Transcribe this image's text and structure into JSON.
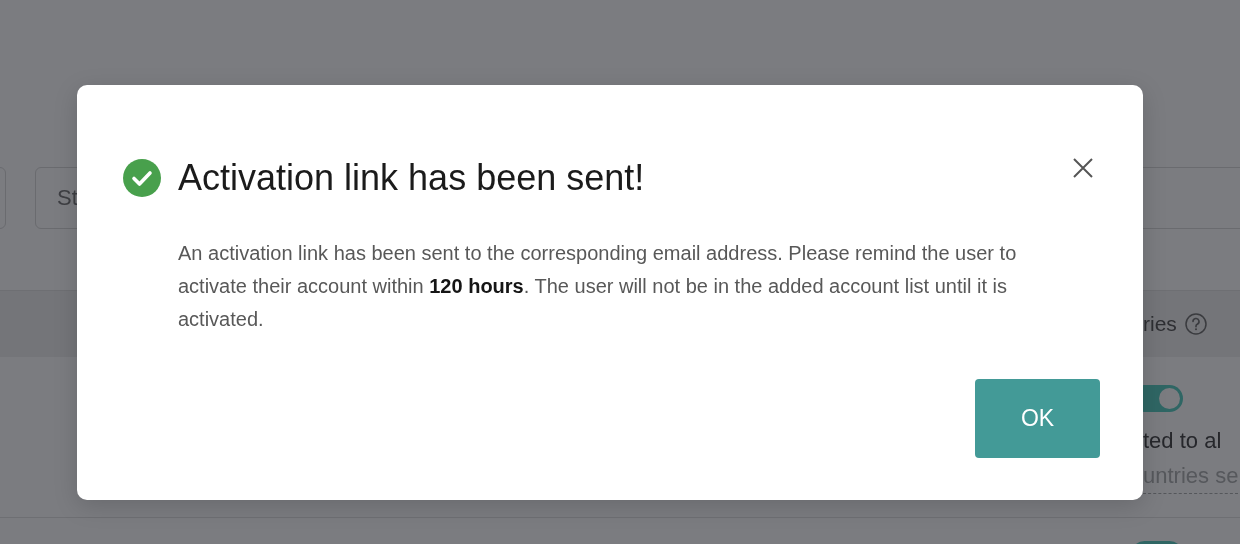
{
  "background": {
    "search": {
      "placeholder": "St"
    },
    "table": {
      "column_header": "ries",
      "rows": [
        {
          "toggle_on": true,
          "line_1": "ted to al",
          "line_2": "untries se"
        },
        {
          "toggle_on": true
        }
      ]
    }
  },
  "dialog": {
    "title": "Activation link has been sent!",
    "kind": "success",
    "message": "An activation link has been sent to the corresponding email address. Please remind the user to activate their account within **120 hours**. The user will not be in the added account list until it is activated.",
    "button": "OK"
  }
}
